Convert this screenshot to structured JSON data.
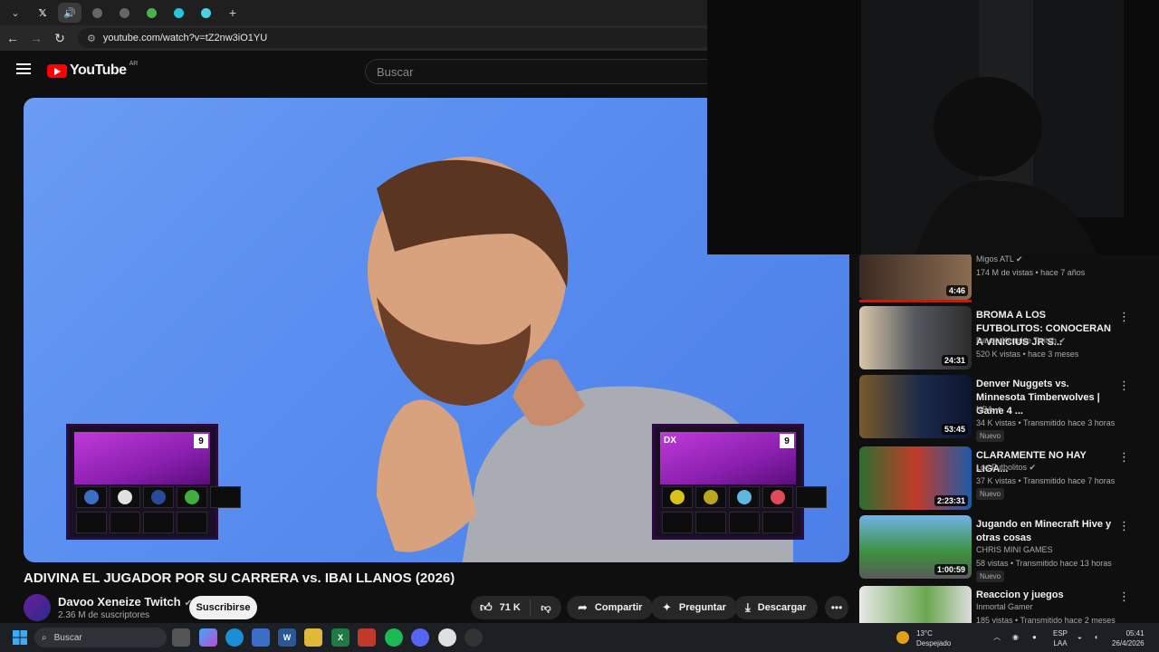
{
  "browser": {
    "url": "youtube.com/watch?v=tZ2nw3iO1YU"
  },
  "youtube": {
    "logo": "YouTube",
    "country": "AR",
    "search_placeholder": "Buscar"
  },
  "video": {
    "title": "ADIVINA EL JUGADOR POR SU CARRERA vs. IBAI LLANOS (2026)",
    "left_card_number": "9",
    "right_card_label": "DX",
    "right_card_number": "9"
  },
  "channel": {
    "name": "Davoo Xeneize Twitch",
    "subscribers": "2.36 M de suscriptores",
    "subscribe_label": "Suscribirse"
  },
  "actions": {
    "likes": "71 K",
    "share": "Compartir",
    "ask": "Preguntar",
    "download": "Descargar"
  },
  "recommendations": [
    {
      "title": "",
      "channel": "Migos ATL",
      "meta": "174 M de vistas • hace 7 años",
      "duration": "4:46",
      "badge": ""
    },
    {
      "title": "BROMA A LOS FUTBOLITOS: CONOCERAN A VINICIUS JR S...",
      "channel": "Davoo Xeneize Twitch",
      "meta": "520 K vistas • hace 3 meses",
      "duration": "24:31",
      "badge": ""
    },
    {
      "title": "Denver Nuggets vs. Minnesota Timberwolves | Game 4 ...",
      "channel": "NBA",
      "meta": "34 K vistas • Transmitido hace 3 horas",
      "duration": "53:45",
      "badge": "Nuevo"
    },
    {
      "title": "CLARAMENTE NO HAY LIGA...",
      "channel": "Los Futbolitos",
      "meta": "37 K vistas • Transmitido hace 7 horas",
      "duration": "2:23:31",
      "badge": "Nuevo"
    },
    {
      "title": "Jugando en Minecraft Hive y otras cosas",
      "channel": "CHRIS MINI GAMES",
      "meta": "58 vistas • Transmitido hace 13 horas",
      "duration": "1:00:59",
      "badge": "Nuevo"
    },
    {
      "title": "Reaccion y juegos",
      "channel": "Inmortal Gamer",
      "meta": "185 vistas • Transmitido hace 2 meses",
      "duration": "",
      "badge": ""
    }
  ],
  "taskbar": {
    "search_placeholder": "Buscar",
    "weather_temp": "13°C",
    "weather_desc": "Despejado",
    "lang_1": "ESP",
    "lang_2": "LAA",
    "time": "05:41",
    "date": "26/4/2026"
  }
}
